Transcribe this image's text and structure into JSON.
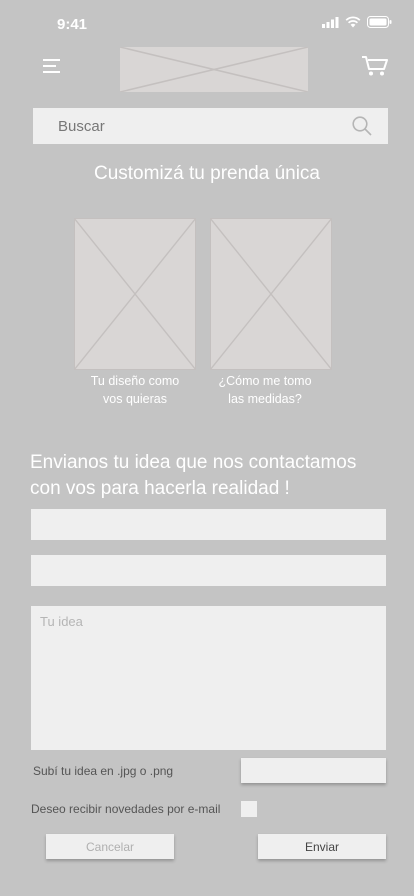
{
  "status_bar": {
    "time": "9:41"
  },
  "header": {
    "menu_icon": "hamburger-menu-icon",
    "logo": "logo-placeholder",
    "cart_icon": "cart-icon"
  },
  "search": {
    "placeholder": "Buscar",
    "icon": "search-icon"
  },
  "customize": {
    "title": "Customizá tu prenda única",
    "cards": [
      {
        "caption_line1": "Tu diseño como",
        "caption_line2": "vos quieras"
      },
      {
        "caption_line1": "¿Cómo me tomo",
        "caption_line2": "las medidas?"
      }
    ]
  },
  "form": {
    "heading_line1": "Envianos tu idea que nos contactamos",
    "heading_line2": "con vos para hacerla realidad !",
    "idea_placeholder": "Tu idea",
    "upload_label": "Subí tu idea en .jpg o .png",
    "newsletter_label": "Deseo recibir novedades por e-mail",
    "cancel_label": "Cancelar",
    "send_label": "Enviar"
  }
}
